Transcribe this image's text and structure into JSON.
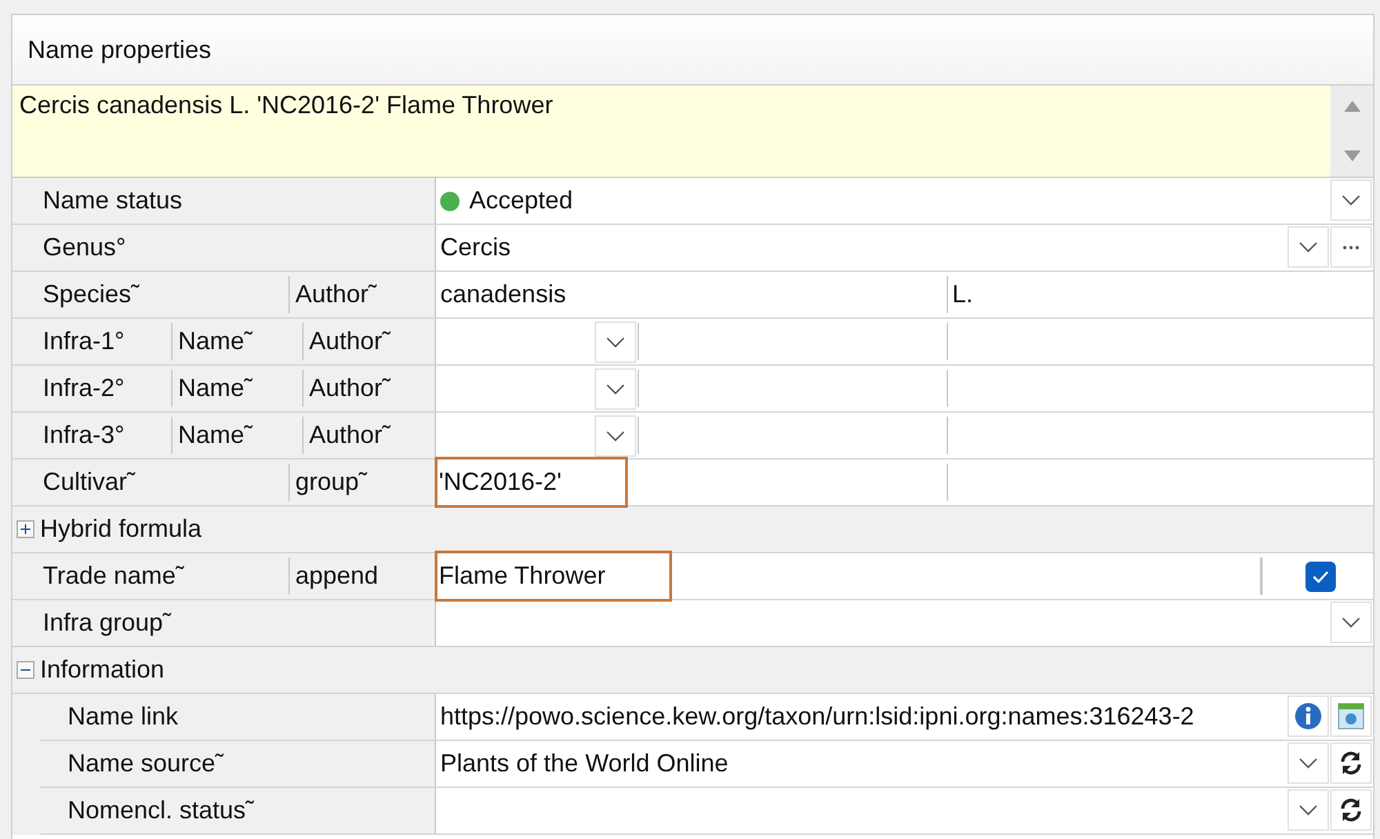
{
  "panel": {
    "title": "Name properties"
  },
  "full_name": "Cercis canadensis L. 'NC2016-2' Flame Thrower",
  "rows": [
    {
      "kind": "field",
      "labels": [
        "Name status"
      ],
      "cells": [
        {
          "kind": "status",
          "value": "Accepted",
          "color": "#4caf50"
        }
      ],
      "buttons": [
        {
          "kind": "dropdown"
        }
      ]
    },
    {
      "kind": "field",
      "labels": [
        "Genus°"
      ],
      "cells": [
        {
          "kind": "text",
          "value": "Cercis",
          "highlighted": false
        }
      ],
      "buttons": [
        {
          "kind": "dropdown"
        },
        {
          "kind": "more"
        }
      ]
    },
    {
      "kind": "field",
      "labels": [
        "Species˜",
        "Author˜"
      ],
      "cells": [
        {
          "kind": "text",
          "value": "canadensis",
          "highlighted": false
        },
        {
          "kind": "text",
          "value": "L.",
          "highlighted": false
        }
      ]
    },
    {
      "kind": "field",
      "labels": [
        "Infra-1°",
        "Name˜",
        "Author˜"
      ],
      "cells": [
        {
          "kind": "combo"
        },
        {
          "kind": "text"
        },
        {
          "kind": "text"
        }
      ]
    },
    {
      "kind": "field",
      "labels": [
        "Infra-2°",
        "Name˜",
        "Author˜"
      ],
      "cells": [
        {
          "kind": "combo"
        },
        {
          "kind": "text"
        },
        {
          "kind": "text"
        }
      ]
    },
    {
      "kind": "field",
      "labels": [
        "Infra-3°",
        "Name˜",
        "Author˜"
      ],
      "cells": [
        {
          "kind": "combo"
        },
        {
          "kind": "text"
        },
        {
          "kind": "text"
        }
      ]
    },
    {
      "kind": "field",
      "labels": [
        "Cultivar˜",
        "group˜"
      ],
      "cells": [
        {
          "kind": "text",
          "value": "'NC2016-2'",
          "highlighted": true
        },
        {
          "kind": "text"
        }
      ]
    },
    {
      "kind": "group",
      "label": "Hybrid formula",
      "expanded": false
    },
    {
      "kind": "field",
      "labels": [
        "Trade name˜",
        "append"
      ],
      "cells": [
        {
          "kind": "text",
          "value": "Flame Thrower",
          "highlighted": true
        },
        {
          "kind": "check",
          "checked": true
        }
      ]
    },
    {
      "kind": "field",
      "labels": [
        "Infra group˜"
      ],
      "cells": [
        {
          "kind": "text"
        }
      ],
      "buttons": [
        {
          "kind": "dropdown"
        }
      ]
    },
    {
      "kind": "group",
      "label": "Information",
      "expanded": true,
      "children": [
        {
          "kind": "field",
          "labels": [
            "Name link"
          ],
          "cells": [
            {
              "kind": "text",
              "value": "https://powo.science.kew.org/taxon/urn:lsid:ipni.org:names:316243-2",
              "highlighted": false
            }
          ],
          "buttons": [
            {
              "kind": "info"
            },
            {
              "kind": "image"
            }
          ]
        },
        {
          "kind": "field",
          "labels": [
            "Name source˜"
          ],
          "cells": [
            {
              "kind": "text",
              "value": "Plants of the World Online",
              "highlighted": false
            }
          ],
          "buttons": [
            {
              "kind": "dropdown"
            },
            {
              "kind": "refresh"
            }
          ]
        },
        {
          "kind": "field",
          "labels": [
            "Nomencl. status˜"
          ],
          "cells": [
            {
              "kind": "text"
            }
          ],
          "buttons": [
            {
              "kind": "dropdown"
            },
            {
              "kind": "refresh"
            }
          ]
        }
      ]
    }
  ]
}
